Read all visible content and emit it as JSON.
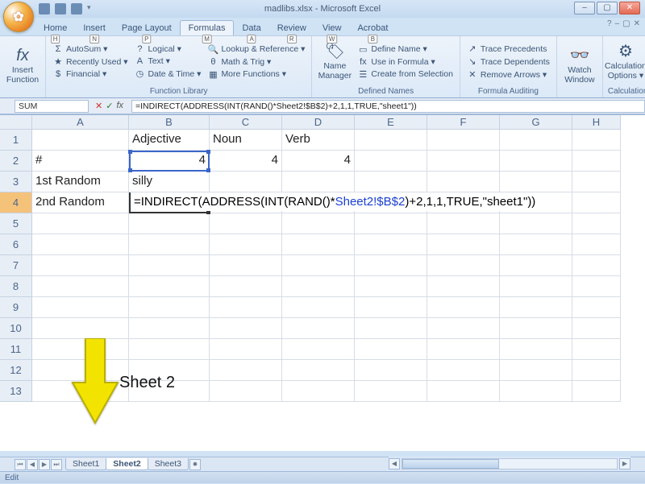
{
  "title": "madlibs.xlsx - Microsoft Excel",
  "tabs": [
    "Home",
    "Insert",
    "Page Layout",
    "Formulas",
    "Data",
    "Review",
    "View",
    "Acrobat"
  ],
  "tab_hints": [
    "H",
    "N",
    "P",
    "M",
    "A",
    "R",
    "W",
    "B"
  ],
  "active_tab": 3,
  "qat_dropdown": "▾",
  "window_buttons": {
    "min": "–",
    "max": "▢",
    "close": "✕"
  },
  "ribbon": {
    "g0": {
      "label": "",
      "insert_function": "Insert Function",
      "fx": "fx"
    },
    "g1": {
      "label": "Function Library",
      "autosum": "AutoSum ▾",
      "recent": "Recently Used ▾",
      "financial": "Financial ▾",
      "logical": "Logical ▾",
      "text": "Text ▾",
      "datetime": "Date & Time ▾",
      "lookup": "Lookup & Reference ▾",
      "mathtrig": "Math & Trig ▾",
      "more": "More Functions ▾"
    },
    "g2": {
      "label": "Defined Names",
      "name_mgr": "Name Manager",
      "define": "Define Name ▾",
      "use": "Use in Formula ▾",
      "create": "Create from Selection"
    },
    "g3": {
      "label": "Formula Auditing",
      "prec": "Trace Precedents",
      "dep": "Trace Dependents",
      "rem": "Remove Arrows ▾"
    },
    "g4": {
      "label": "",
      "watch": "Watch Window"
    },
    "g5": {
      "label": "Calculation",
      "calc": "Calculation Options ▾"
    }
  },
  "namebox": "SUM",
  "formula_btns": {
    "cancel": "✕",
    "enter": "✓",
    "fx": "fx"
  },
  "formula": "=INDIRECT(ADDRESS(INT(RAND()*Sheet2!$B$2)+2,1,1,TRUE,\"sheet1\"))",
  "cols": [
    {
      "letter": "A",
      "w": 120
    },
    {
      "letter": "B",
      "w": 100
    },
    {
      "letter": "C",
      "w": 90
    },
    {
      "letter": "D",
      "w": 90
    },
    {
      "letter": "E",
      "w": 90
    },
    {
      "letter": "F",
      "w": 90
    },
    {
      "letter": "G",
      "w": 90
    },
    {
      "letter": "H",
      "w": 60
    }
  ],
  "rows": [
    "1",
    "2",
    "3",
    "4",
    "5",
    "6",
    "7",
    "8",
    "9",
    "10",
    "11",
    "12",
    "13"
  ],
  "active_row": "4",
  "data": {
    "A2": "#",
    "A3": "1st Random",
    "A4": "2nd Random",
    "B1": "Adjective",
    "B2": "4",
    "B3": "silly",
    "C1": "Noun",
    "C2": "4",
    "D1": "Verb",
    "D2": "4"
  },
  "cell_formula": {
    "pre": "=INDIRECT(ADDRESS(INT(RAND()*",
    "ref": "Sheet2!$B$2",
    "post": ")+2,1,1,TRUE,\"sheet1\"))"
  },
  "sheets": [
    "Sheet1",
    "Sheet2",
    "Sheet3"
  ],
  "active_sheet": 1,
  "status": "Edit",
  "annotation_label": "Sheet 2"
}
